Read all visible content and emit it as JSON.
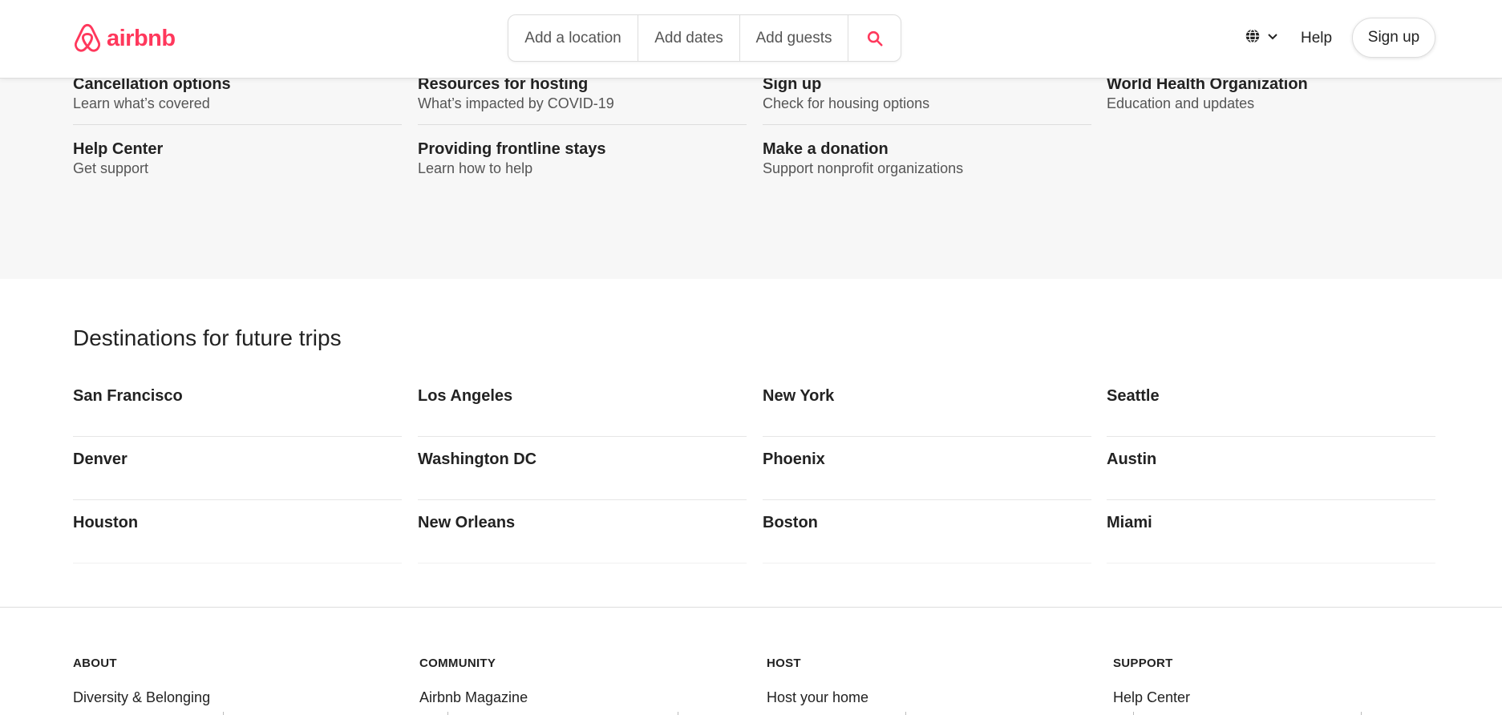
{
  "brand": {
    "name": "airbnb",
    "color": "#ff385c"
  },
  "search": {
    "location": "Add a location",
    "dates": "Add dates",
    "guests": "Add guests",
    "search_icon": "search-icon"
  },
  "nav": {
    "language_icon": "globe-icon",
    "help": "Help",
    "signup": "Sign up"
  },
  "resources": [
    [
      {
        "title": "Cancellation options",
        "sub": "Learn what’s covered"
      },
      {
        "title": "Help Center",
        "sub": "Get support"
      }
    ],
    [
      {
        "title": "Resources for hosting",
        "sub": "What’s impacted by COVID-19"
      },
      {
        "title": "Providing frontline stays",
        "sub": "Learn how to help"
      }
    ],
    [
      {
        "title": "Sign up",
        "sub": "Check for housing options"
      },
      {
        "title": "Make a donation",
        "sub": "Support nonprofit organizations"
      }
    ],
    [
      {
        "title": "World Health Organization",
        "sub": "Education and updates"
      }
    ]
  ],
  "destinations": {
    "title": "Destinations for future trips",
    "columns": [
      [
        "San Francisco",
        "Denver",
        "Houston"
      ],
      [
        "Los Angeles",
        "Washington DC",
        "New Orleans"
      ],
      [
        "New York",
        "Phoenix",
        "Boston"
      ],
      [
        "Seattle",
        "Austin",
        "Miami"
      ]
    ]
  },
  "footer": [
    {
      "heading": "ABOUT",
      "link": "Diversity & Belonging"
    },
    {
      "heading": "COMMUNITY",
      "link": "Airbnb Magazine"
    },
    {
      "heading": "HOST",
      "link": "Host your home"
    },
    {
      "heading": "SUPPORT",
      "link": "Help Center"
    }
  ]
}
